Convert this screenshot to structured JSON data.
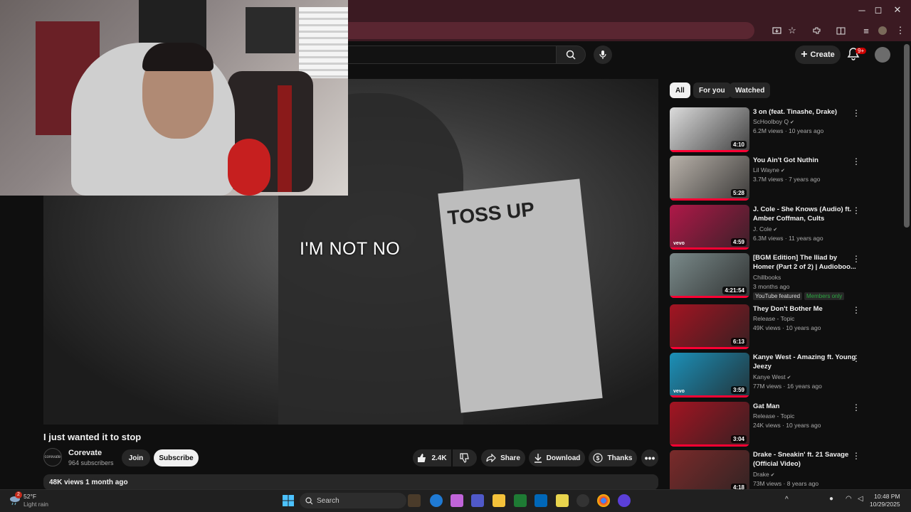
{
  "browser": {
    "window_controls": {
      "minimize": "─",
      "maximize": "◻",
      "close": "✕"
    }
  },
  "youtube": {
    "create_label": "Create",
    "notification_count": "9+"
  },
  "video": {
    "caption": "I'M NOT NO",
    "poster_text": "TOSS UP",
    "title": "I just wanted it to stop",
    "channel": {
      "name": "Corevate",
      "subscribers": "964 subscribers",
      "avatar_text": "corevate"
    },
    "join_label": "Join",
    "subscribe_label": "Subscribe",
    "likes": "2.4K",
    "share_label": "Share",
    "download_label": "Download",
    "thanks_label": "Thanks",
    "views_line": "48K views  1 month ago"
  },
  "chips": [
    {
      "label": "All"
    },
    {
      "label": "For you"
    },
    {
      "label": "Watched"
    }
  ],
  "recommendations": [
    {
      "title": "3 on (feat. Tinashe, Drake)",
      "channel": "ScHoolboy Q",
      "meta": "6.2M views · 10 years ago",
      "duration": "4:10",
      "color": "#dcdcdc",
      "verified": true
    },
    {
      "title": "You Ain't Got Nuthin",
      "channel": "Lil Wayne",
      "meta": "3.7M views · 7 years ago",
      "duration": "5:28",
      "color": "#b9b2aa",
      "verified": true
    },
    {
      "title": "J. Cole - She Knows (Audio) ft. Amber Coffman, Cults",
      "channel": "J. Cole",
      "meta": "6.3M views · 11 years ago",
      "duration": "4:59",
      "color": "#b01848",
      "vevo": "vevo",
      "verified": true
    },
    {
      "title": "[BGM Edition] The Iliad by Homer (Part 2 of 2) | Audioboo...",
      "channel": "Chillbooks",
      "meta": "3 months ago",
      "duration": "4:21:54",
      "color": "#7a8a8a",
      "tags": [
        "YouTube featured",
        "Members only"
      ]
    },
    {
      "title": "They Don't Bother Me",
      "channel": "Release - Topic",
      "meta": "49K views · 10 years ago",
      "duration": "6:13",
      "color": "#a31422"
    },
    {
      "title": "Kanye West - Amazing ft. Young Jeezy",
      "channel": "Kanye West",
      "meta": "77M views · 16 years ago",
      "duration": "3:59",
      "color": "#1c90b8",
      "vevo": "vevo",
      "verified": true
    },
    {
      "title": "Gat Man",
      "channel": "Release - Topic",
      "meta": "24K views · 10 years ago",
      "duration": "3:04",
      "color": "#a31422"
    },
    {
      "title": "Drake - Sneakin' ft. 21 Savage (Official Video)",
      "channel": "Drake",
      "meta": "73M views · 8 years ago",
      "duration": "4:18",
      "color": "#7a2a2a",
      "verified": true
    }
  ],
  "taskbar": {
    "weather_temp": "52°F",
    "weather_desc": "Light rain",
    "weather_badge": "2",
    "search_placeholder": "Search",
    "time": "10:48 PM",
    "date": "10/29/2025"
  }
}
